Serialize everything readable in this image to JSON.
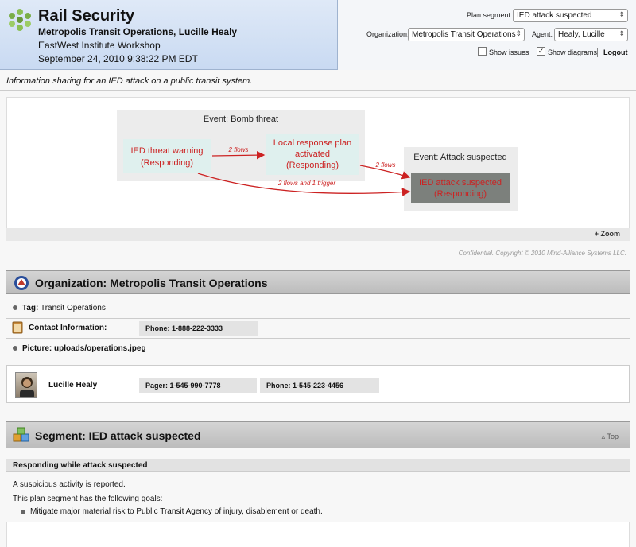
{
  "header": {
    "app_title": "Rail Security",
    "organization": "Metropolis Transit Operations,",
    "user_name": "Lucille Healy",
    "workshop": "EastWest Institute Workshop",
    "datetime": "September 24, 2010 9:38:22 PM EDT"
  },
  "controls": {
    "plan_segment_label": "Plan segment:",
    "plan_segment_value": "IED attack suspected",
    "organization_label": "Organization:",
    "organization_value": "Metropolis Transit Operations",
    "agent_label": "Agent:",
    "agent_value": "Healy, Lucille",
    "show_issues_label": "Show issues",
    "show_issues_checked": false,
    "show_diagrams_label": "Show diagrams",
    "show_diagrams_checked": true,
    "logout_label": "Logout"
  },
  "description": "Information sharing for an IED attack on a public transit system.",
  "diagram": {
    "event1_label": "Event: Bomb threat",
    "event2_label": "Event: Attack suspected",
    "node1_line1": "IED threat warning",
    "node1_line2": "(Responding)",
    "node2_line1": "Local response plan",
    "node2_line2": "activated",
    "node2_line3": "(Responding)",
    "node3_line1": "IED attack suspected",
    "node3_line2": "(Responding)",
    "edge1_label": "2 flows",
    "edge2_label": "2 flows",
    "edge3_label": "2 flows and 1 trigger",
    "zoom_label": "+ Zoom",
    "copyright": "Confidential. Copyright © 2010 Mind-Alliance Systems LLC.",
    "colors": {
      "edge": "#cc2222",
      "node_bg": "#dff0ee",
      "event_bg": "#ececec",
      "highlight_node_bg": "#7c807c"
    }
  },
  "org_section": {
    "title": "Organization: Metropolis Transit Operations",
    "tag_label": "Tag:",
    "tag_value": "Transit Operations",
    "contact_label": "Contact Information:",
    "contact_phone": "Phone: 1-888-222-3333",
    "picture_label": "Picture:",
    "picture_value": "uploads/operations.jpeg"
  },
  "agent": {
    "name": "Lucille Healy",
    "pager": "Pager: 1-545-990-7778",
    "phone": "Phone: 1-545-223-4456"
  },
  "segment_section": {
    "title": "Segment: IED attack suspected",
    "top_link": "Top",
    "subheader": "Responding while attack suspected",
    "summary": "A suspicious activity is reported.",
    "goals_intro": "This plan segment has the following goals:",
    "goals": [
      "Mitigate major material risk to Public Transit Agency of injury, disablement or death."
    ]
  }
}
